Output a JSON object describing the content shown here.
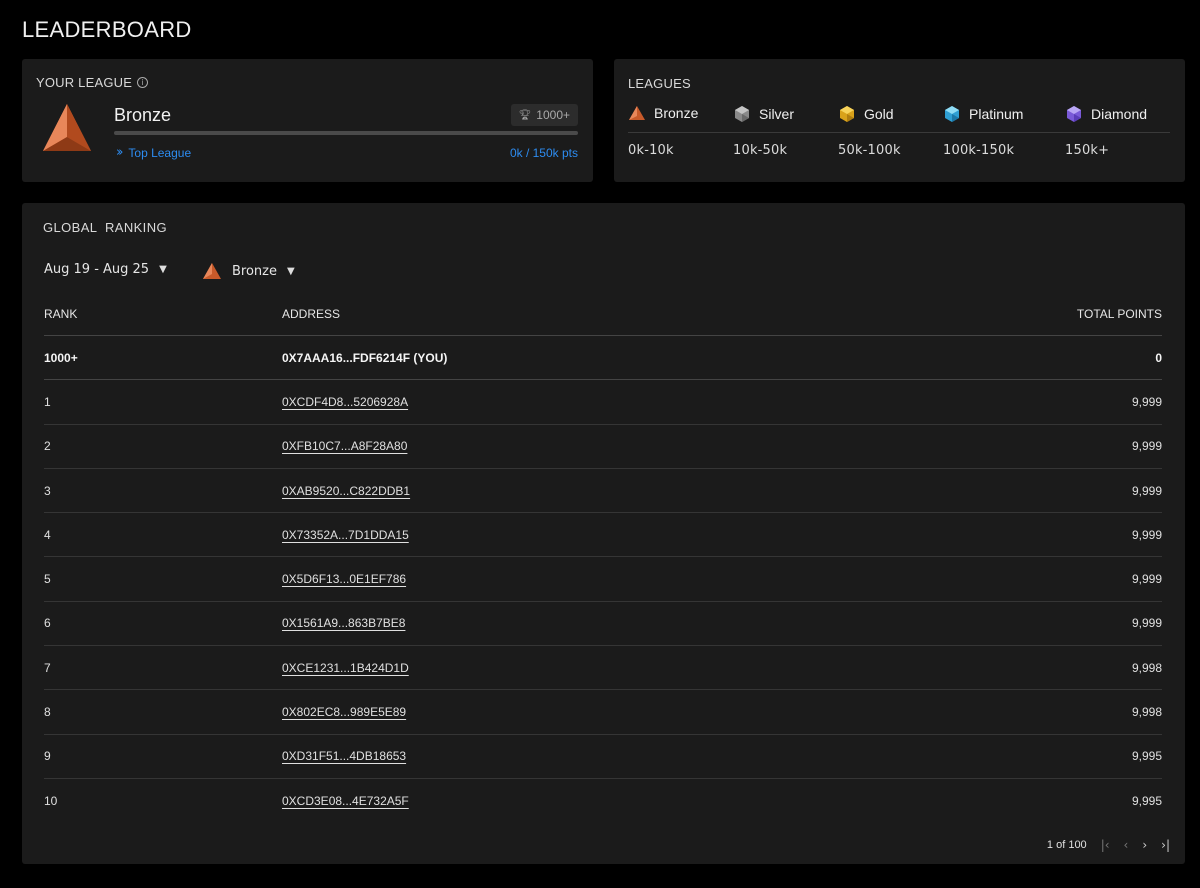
{
  "page": {
    "title": "LEADERBOARD"
  },
  "your_league": {
    "title": "YOUR LEAGUE",
    "info_icon": "ⓘ",
    "league_name": "Bronze",
    "rank_badge": "1000+",
    "trophy_icon": "🏆",
    "progress_fraction": 0,
    "top_league_label": "Top League",
    "points_text": "0k / 150k pts"
  },
  "leagues": {
    "title": "LEAGUES",
    "items": [
      {
        "name": "Bronze",
        "range": "0k-10k",
        "color": "#d9713f"
      },
      {
        "name": "Silver",
        "range": "10k-50k",
        "color": "#9a9a9a"
      },
      {
        "name": "Gold",
        "range": "50k-100k",
        "color": "#e8b923"
      },
      {
        "name": "Platinum",
        "range": "100k-150k",
        "color": "#3fb6e8"
      },
      {
        "name": "Diamond",
        "range": "150k+",
        "color": "#8b6fe8"
      }
    ]
  },
  "global_ranking": {
    "title": "GLOBAL  RANKING",
    "date_filter": "Aug 19 - Aug 25",
    "league_filter": "Bronze",
    "columns": {
      "rank": "RANK",
      "address": "ADDRESS",
      "points": "TOTAL POINTS"
    },
    "you_row": {
      "rank": "1000+",
      "address": "0X7AAA16...FDF6214F (YOU)",
      "points": "0"
    },
    "rows": [
      {
        "rank": "1",
        "address": "0XCDF4D8...5206928A",
        "points": "9,999"
      },
      {
        "rank": "2",
        "address": "0XFB10C7...A8F28A80",
        "points": "9,999"
      },
      {
        "rank": "3",
        "address": "0XAB9520...C822DDB1",
        "points": "9,999"
      },
      {
        "rank": "4",
        "address": "0X73352A...7D1DDA15",
        "points": "9,999"
      },
      {
        "rank": "5",
        "address": "0X5D6F13...0E1EF786",
        "points": "9,999"
      },
      {
        "rank": "6",
        "address": "0X1561A9...863B7BE8",
        "points": "9,999"
      },
      {
        "rank": "7",
        "address": "0XCE1231...1B424D1D",
        "points": "9,998"
      },
      {
        "rank": "8",
        "address": "0X802EC8...989E5E89",
        "points": "9,998"
      },
      {
        "rank": "9",
        "address": "0XD31F51...4DB18653",
        "points": "9,995"
      },
      {
        "rank": "10",
        "address": "0XCD3E08...4E732A5F",
        "points": "9,995"
      }
    ],
    "pagination": {
      "text": "1 of 100",
      "first": "|‹",
      "prev": "‹",
      "next": "›",
      "last": "›|"
    }
  }
}
